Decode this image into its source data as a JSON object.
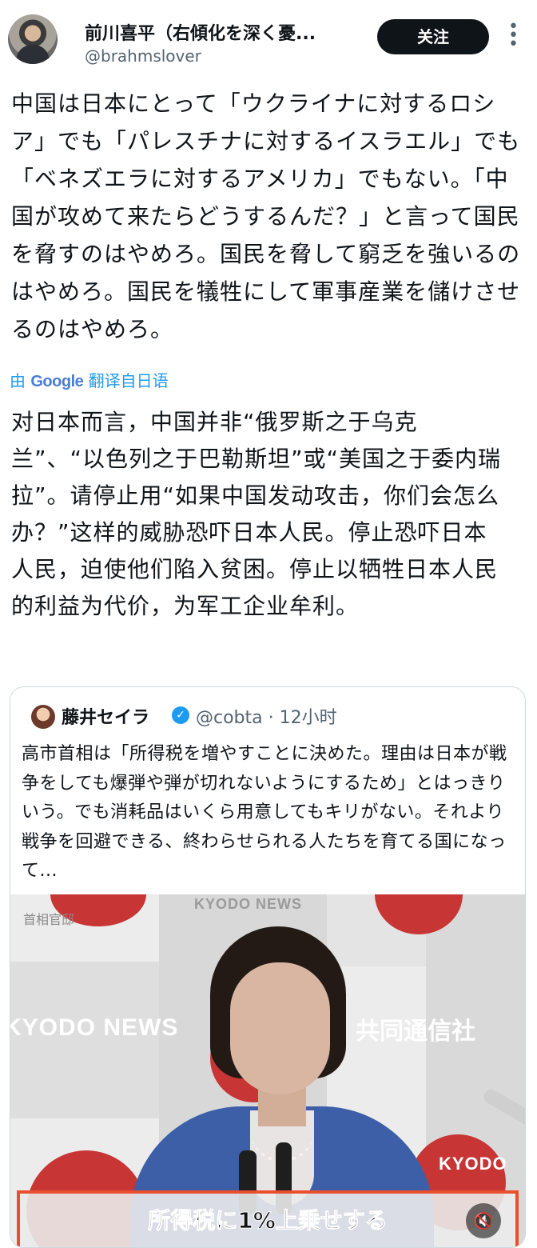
{
  "author": {
    "display_name": "前川喜平（右傾化を深く憂...",
    "handle": "@brahmslover",
    "follow_label": "关注",
    "more_label": "⋮"
  },
  "post": {
    "original_text": "中国は日本にとって「ウクライナに対するロシア」でも「パレスチナに対するイスラエル」でも「ベネズエラに対するアメリカ」でもない。「中国が攻めて来たらどうするんだ？」と言って国民を脅すのはやめろ。国民を脅して窮乏を強いるのはやめろ。国民を犠牲にして軍事産業を儲けさせるのはやめろ。",
    "translated_prefix": "由 ",
    "translated_brand": "Google",
    "translated_suffix": " 翻译自日语",
    "translated_text": "对日本而言，中国并非“俄罗斯之于乌克兰”、“以色列之于巴勒斯坦”或“美国之于委内瑞拉”。请停止用“如果中国发动攻击，你们会怎么办？”这样的威胁恐吓日本人民。停止恐吓日本人民，迫使他们陷入贫困。停止以牺牲日本人民的利益为代价，为军工企业牟利。"
  },
  "quote": {
    "name": "藤井セイラ",
    "verified_glyph": "✓",
    "handle_time": "@cobta · 12小时",
    "text": "高市首相は「所得税を増やすことに決めた。理由は日本が戦争をしても爆弾や弾が切れないようにするため」とはっきりいう。でも消耗品はいくら用意してもキリがない。それより戦争を回避できる、終わらせられる人たちを育てる国になって...",
    "video": {
      "corner_text": "首相官邸",
      "brand_en": "KYODO NEWS",
      "brand_jp": "共同通信社",
      "brand_en_right": "KYODO",
      "top_label": "KYODO NEWS",
      "subtitle": "所得税に1%上乗せする",
      "mute_icon": "🔇"
    }
  },
  "colors": {
    "accent_blue": "#1d9bf0",
    "follow_bg": "#0f1419",
    "subtitle_border": "#e94f2d",
    "kyodo_red": "#c73535"
  }
}
